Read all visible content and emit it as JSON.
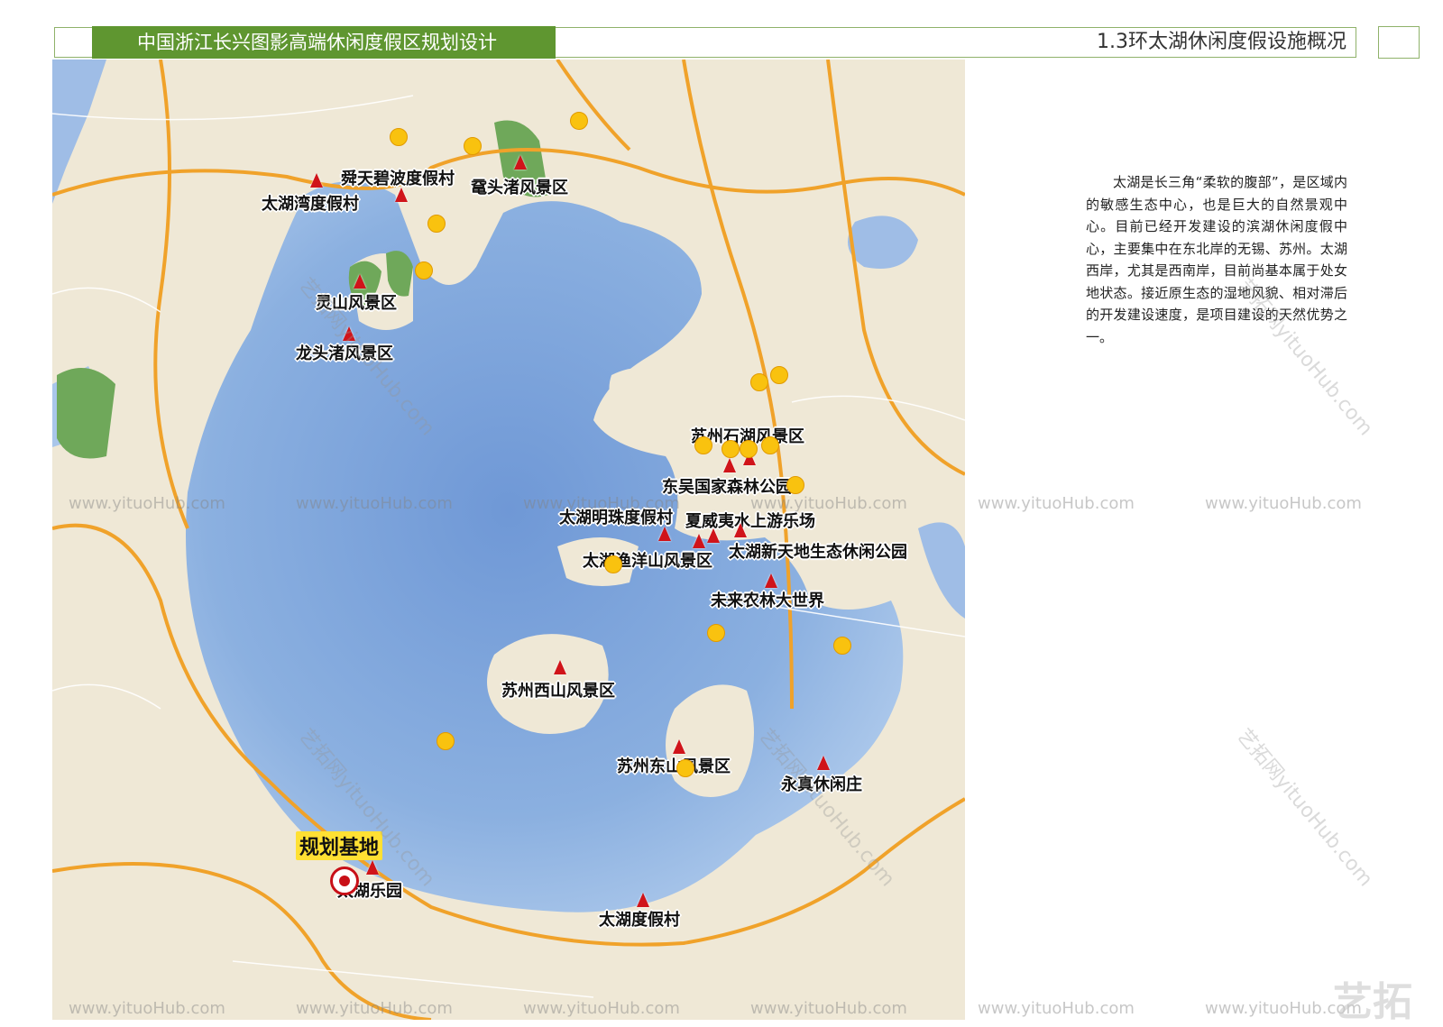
{
  "header": {
    "project_title": "中国浙江长兴图影高端休闲度假区规划设计",
    "section_title": "1.3环太湖休闲度假设施概况"
  },
  "map": {
    "labels": [
      "舜天碧波度假村",
      "鼋头渚风景区",
      "太湖湾度假村",
      "灵山风景区",
      "龙头渚风景区",
      "苏州石湖风景区",
      "东吴国家森林公园",
      "太湖明珠度假村",
      "夏威夷水上游乐场",
      "太湖新天地生态休闲公园",
      "太湖渔洋山风景区",
      "未来农林大世界",
      "苏州西山风景区",
      "苏州东山风景区",
      "永真休闲庄",
      "太湖乐园",
      "太湖度假村"
    ],
    "plan_base_label": "规划基地",
    "colors": {
      "lake": "#7ea6dc",
      "land": "#efe8d6",
      "road": "#f0a22a",
      "forest": "#6fa85a",
      "marker": "#d0141a",
      "facility_dot": "#f9c20f"
    }
  },
  "description": "太湖是长三角“柔软的腹部”，是区域内的敏感生态中心，也是巨大的自然景观中心。目前已经开发建设的滨湖休闲度假中心，主要集中在东北岸的无锡、苏州。太湖西岸，尤其是西南岸，目前尚基本属于处女地状态。接近原生态的湿地风貌、相对滞后的开发建设速度，是项目建设的天然优势之一。",
  "watermark": {
    "text": "www.yituoHub.com",
    "diagonal_text": "艺拓网yituoHub.com",
    "brand": "艺拓"
  }
}
